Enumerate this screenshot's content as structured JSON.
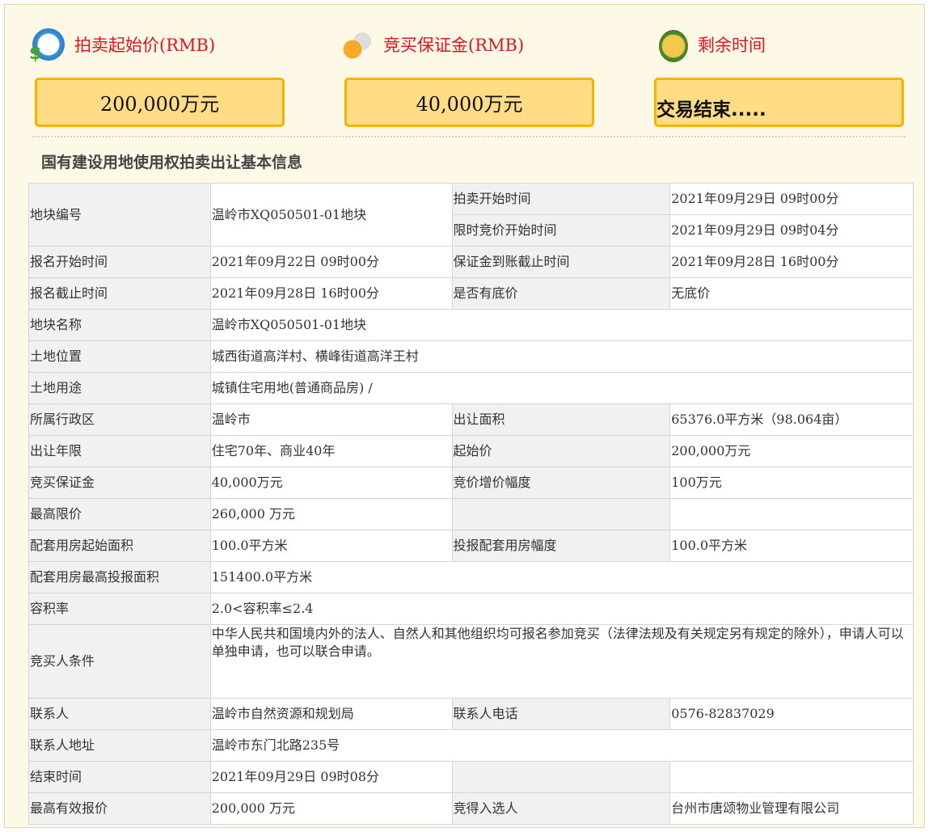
{
  "summary": {
    "start_price": {
      "label": "拍卖起始价(RMB)",
      "value": "200,000万元",
      "icon": "money-clock-icon"
    },
    "deposit": {
      "label": "竞买保证金(RMB)",
      "value": "40,000万元",
      "icon": "coins-icon"
    },
    "remaining": {
      "label": "剩余时间",
      "value": "交易结束.....",
      "icon": "alarm-clock-icon"
    }
  },
  "section_title": "国有建设用地使用权拍卖出让基本信息",
  "colors": {
    "header_text": "#e0141e",
    "box_fill": "#ffdc85",
    "box_border": "#f9b100",
    "label_bg": "#f1f1f1"
  },
  "rows": [
    {
      "cells": [
        {
          "t": "地块编号",
          "l": 1,
          "rs": 2
        },
        {
          "t": "温岭市XQ050501-01地块",
          "rs": 2
        },
        {
          "t": "拍卖开始时间",
          "l": 1
        },
        {
          "t": "2021年09月29日 09时00分"
        }
      ]
    },
    {
      "cells": [
        {
          "t": "限时竞价开始时间",
          "l": 1
        },
        {
          "t": "2021年09月29日 09时04分"
        }
      ]
    },
    {
      "cells": [
        {
          "t": "报名开始时间",
          "l": 1
        },
        {
          "t": "2021年09月22日 09时00分"
        },
        {
          "t": "保证金到账截止时间",
          "l": 1
        },
        {
          "t": "2021年09月28日 16时00分"
        }
      ]
    },
    {
      "cells": [
        {
          "t": "报名截止时间",
          "l": 1
        },
        {
          "t": "2021年09月28日 16时00分"
        },
        {
          "t": "是否有底价",
          "l": 1
        },
        {
          "t": "无底价"
        }
      ]
    },
    {
      "cells": [
        {
          "t": "地块名称",
          "l": 1
        },
        {
          "t": "温岭市XQ050501-01地块",
          "cs": 3
        }
      ]
    },
    {
      "cells": [
        {
          "t": "土地位置",
          "l": 1
        },
        {
          "t": "城西街道高洋村、横峰街道高洋王村",
          "cs": 3
        }
      ]
    },
    {
      "cells": [
        {
          "t": "土地用途",
          "l": 1
        },
        {
          "t": "城镇住宅用地(普通商品房) /",
          "cs": 3
        }
      ]
    },
    {
      "cells": [
        {
          "t": "所属行政区",
          "l": 1
        },
        {
          "t": "温岭市"
        },
        {
          "t": "出让面积",
          "l": 1
        },
        {
          "t": "65376.0平方米（98.064亩）"
        }
      ]
    },
    {
      "cells": [
        {
          "t": "出让年限",
          "l": 1
        },
        {
          "t": "住宅70年、商业40年"
        },
        {
          "t": "起始价",
          "l": 1
        },
        {
          "t": "200,000万元"
        }
      ]
    },
    {
      "cells": [
        {
          "t": "竞买保证金",
          "l": 1
        },
        {
          "t": "40,000万元"
        },
        {
          "t": "竞价增价幅度",
          "l": 1
        },
        {
          "t": "100万元"
        }
      ]
    },
    {
      "cells": [
        {
          "t": "最高限价",
          "l": 1
        },
        {
          "t": "260,000 万元"
        },
        {
          "t": "",
          "l": 1
        },
        {
          "t": ""
        }
      ]
    },
    {
      "cells": [
        {
          "t": "配套用房起始面积",
          "l": 1
        },
        {
          "t": "100.0平方米"
        },
        {
          "t": "投报配套用房幅度",
          "l": 1
        },
        {
          "t": "100.0平方米"
        }
      ]
    },
    {
      "cells": [
        {
          "t": "配套用房最高投报面积",
          "l": 1
        },
        {
          "t": "151400.0平方米",
          "cs": 3
        }
      ]
    },
    {
      "cells": [
        {
          "t": "容积率",
          "l": 1
        },
        {
          "t": "2.0<容积率≤2.4",
          "cs": 3
        }
      ]
    },
    {
      "tall": 1,
      "cells": [
        {
          "t": "竞买人条件",
          "l": 1
        },
        {
          "t": "中华人民共和国境内外的法人、自然人和其他组织均可报名参加竞买（法律法规及有关规定另有规定的除外），申请人可以单独申请，也可以联合申请。",
          "cs": 3
        }
      ]
    },
    {
      "cells": [
        {
          "t": "联系人",
          "l": 1
        },
        {
          "t": "温岭市自然资源和规划局"
        },
        {
          "t": "联系人电话",
          "l": 1
        },
        {
          "t": "0576-82837029"
        }
      ]
    },
    {
      "cells": [
        {
          "t": "联系人地址",
          "l": 1
        },
        {
          "t": "温岭市东门北路235号",
          "cs": 3
        }
      ]
    },
    {
      "cells": [
        {
          "t": "结束时间",
          "l": 1
        },
        {
          "t": "2021年09月29日 09时08分"
        },
        {
          "t": "",
          "l": 1
        },
        {
          "t": ""
        }
      ]
    },
    {
      "cells": [
        {
          "t": "最高有效报价",
          "l": 1
        },
        {
          "t": "200,000 万元"
        },
        {
          "t": "竞得入选人",
          "l": 1
        },
        {
          "t": "台州市唐颂物业管理有限公司"
        }
      ]
    }
  ]
}
